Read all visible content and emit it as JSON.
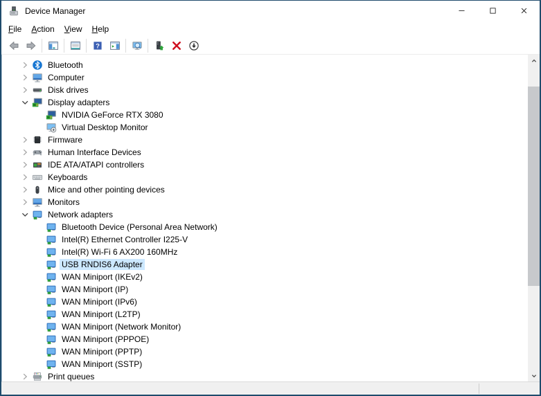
{
  "window": {
    "title": "Device Manager",
    "controls": [
      "minimize",
      "maximize",
      "close"
    ]
  },
  "colors": {
    "window_border": "#1f4b6c",
    "selection": "#cce8ff",
    "statusbar_bg": "#f0f0f0"
  },
  "menu": {
    "items": [
      {
        "label": "File"
      },
      {
        "label": "Action"
      },
      {
        "label": "View"
      },
      {
        "label": "Help"
      }
    ]
  },
  "toolbar": {
    "items": [
      {
        "type": "button",
        "icon": "back"
      },
      {
        "type": "button",
        "icon": "forward"
      },
      {
        "type": "separator"
      },
      {
        "type": "button",
        "icon": "show-console-tree"
      },
      {
        "type": "separator"
      },
      {
        "type": "button",
        "icon": "properties"
      },
      {
        "type": "separator"
      },
      {
        "type": "button",
        "icon": "help"
      },
      {
        "type": "button",
        "icon": "show-action-pane"
      },
      {
        "type": "separator"
      },
      {
        "type": "button",
        "icon": "scan-hardware-changes"
      },
      {
        "type": "separator"
      },
      {
        "type": "button",
        "icon": "update-driver"
      },
      {
        "type": "button",
        "icon": "uninstall-device"
      },
      {
        "type": "button",
        "icon": "disable-device"
      }
    ]
  },
  "tree": {
    "rows": [
      {
        "label": "Bluetooth",
        "level": 0,
        "icon": "bluetooth",
        "state": "collapsed"
      },
      {
        "label": "Computer",
        "level": 0,
        "icon": "computer",
        "state": "collapsed"
      },
      {
        "label": "Disk drives",
        "level": 0,
        "icon": "disk-drive",
        "state": "collapsed"
      },
      {
        "label": "Display adapters",
        "level": 0,
        "icon": "display-adapter",
        "state": "expanded"
      },
      {
        "label": "NVIDIA GeForce RTX 3080",
        "level": 1,
        "icon": "display-adapter"
      },
      {
        "label": "Virtual Desktop Monitor",
        "level": 1,
        "icon": "virtual-monitor"
      },
      {
        "label": "Firmware",
        "level": 0,
        "icon": "firmware-chip",
        "state": "collapsed"
      },
      {
        "label": "Human Interface Devices",
        "level": 0,
        "icon": "hid-gamepad",
        "state": "collapsed"
      },
      {
        "label": "IDE ATA/ATAPI controllers",
        "level": 0,
        "icon": "ide-controller",
        "state": "collapsed"
      },
      {
        "label": "Keyboards",
        "level": 0,
        "icon": "keyboard",
        "state": "collapsed"
      },
      {
        "label": "Mice and other pointing devices",
        "level": 0,
        "icon": "mouse",
        "state": "collapsed"
      },
      {
        "label": "Monitors",
        "level": 0,
        "icon": "monitor",
        "state": "collapsed"
      },
      {
        "label": "Network adapters",
        "level": 0,
        "icon": "network-adapter",
        "state": "expanded"
      },
      {
        "label": "Bluetooth Device (Personal Area Network)",
        "level": 1,
        "icon": "network-adapter"
      },
      {
        "label": "Intel(R) Ethernet Controller I225-V",
        "level": 1,
        "icon": "network-adapter"
      },
      {
        "label": "Intel(R) Wi-Fi 6 AX200 160MHz",
        "level": 1,
        "icon": "network-adapter"
      },
      {
        "label": "USB RNDIS6 Adapter",
        "level": 1,
        "icon": "network-adapter",
        "selected": true
      },
      {
        "label": "WAN Miniport (IKEv2)",
        "level": 1,
        "icon": "network-adapter"
      },
      {
        "label": "WAN Miniport (IP)",
        "level": 1,
        "icon": "network-adapter"
      },
      {
        "label": "WAN Miniport (IPv6)",
        "level": 1,
        "icon": "network-adapter"
      },
      {
        "label": "WAN Miniport (L2TP)",
        "level": 1,
        "icon": "network-adapter"
      },
      {
        "label": "WAN Miniport (Network Monitor)",
        "level": 1,
        "icon": "network-adapter"
      },
      {
        "label": "WAN Miniport (PPPOE)",
        "level": 1,
        "icon": "network-adapter"
      },
      {
        "label": "WAN Miniport (PPTP)",
        "level": 1,
        "icon": "network-adapter"
      },
      {
        "label": "WAN Miniport (SSTP)",
        "level": 1,
        "icon": "network-adapter"
      },
      {
        "label": "Print queues",
        "level": 0,
        "icon": "printer",
        "state": "collapsed"
      }
    ]
  },
  "statusbar": {
    "text": ""
  }
}
